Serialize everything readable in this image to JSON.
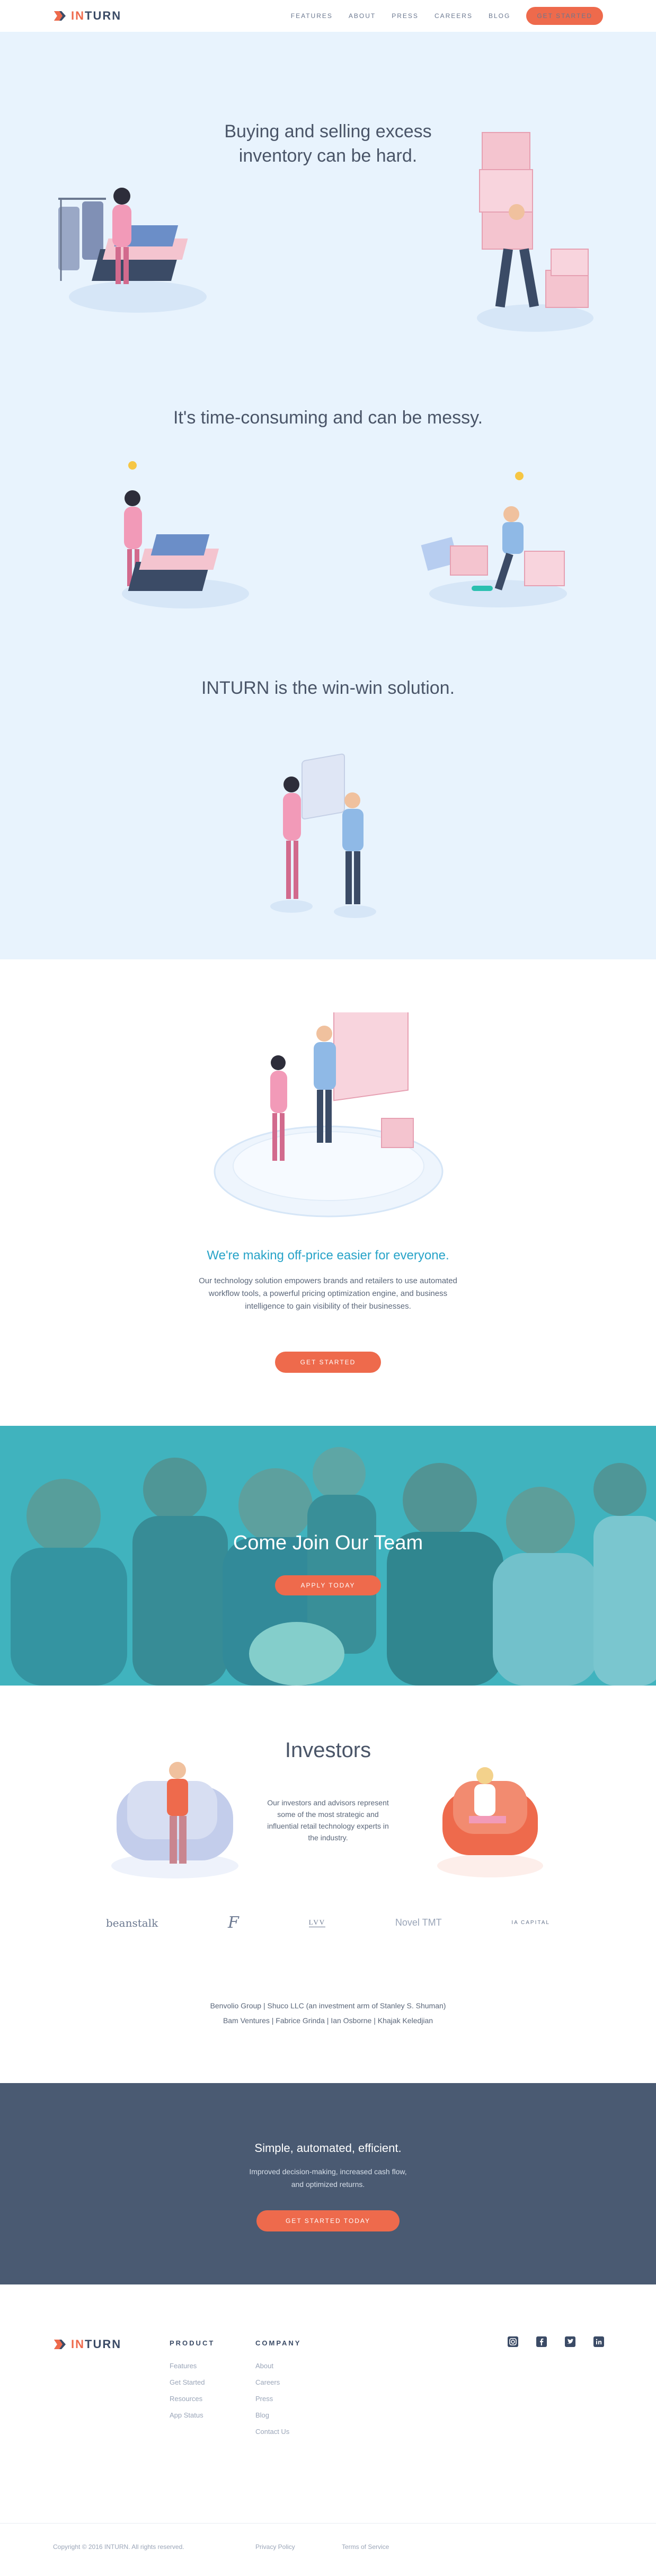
{
  "brand": {
    "name_prefix": "IN",
    "name_suffix": "TURN",
    "accent": "#ee6a4c",
    "dark": "#3b4b66",
    "teal": "#27a3c8"
  },
  "nav": {
    "items": [
      "FEATURES",
      "ABOUT",
      "PRESS",
      "CAREERS",
      "BLOG"
    ],
    "cta": "GET STARTED"
  },
  "hero": {
    "headline_1": "Buying and selling excess",
    "headline_2": "inventory can be hard.",
    "headline_3": "It's time-consuming and can be messy.",
    "headline_4": "INTURN is the win-win solution."
  },
  "offprice": {
    "tagline": "We're making off-price easier for everyone.",
    "description": "Our technology solution empowers brands and retailers to use automated workflow tools, a powerful pricing optimization engine, and business intelligence to gain visibility of their businesses.",
    "cta": "GET STARTED"
  },
  "team": {
    "title": "Come Join Our Team",
    "cta": "APPLY TODAY"
  },
  "investors": {
    "title": "Investors",
    "description": "Our investors and advisors represent some of the most strategic and influential retail technology experts in the industry.",
    "logos": [
      "beanstalk",
      "F",
      "LVV",
      "Novel TMT",
      "IA CAPITAL"
    ],
    "names_line_1": "Benvolio Group  |  Shuco LLC (an investment arm of Stanley S. Shuman)",
    "names_line_2": "Bam Ventures  |  Fabrice Grinda  |  Ian Osborne  |  Khajak Keledjian"
  },
  "closing": {
    "title": "Simple, automated, efficient.",
    "description_1": "Improved decision-making, increased cash flow,",
    "description_2": "and optimized returns.",
    "cta": "GET STARTED TODAY"
  },
  "footer": {
    "product_heading": "PRODUCT",
    "product_links": [
      "Features",
      "Get Started",
      "Resources",
      "App Status"
    ],
    "company_heading": "COMPANY",
    "company_links": [
      "About",
      "Careers",
      "Press",
      "Blog",
      "Contact Us"
    ],
    "social": [
      "instagram-icon",
      "facebook-icon",
      "twitter-icon",
      "linkedin-icon"
    ],
    "copyright": "Copyright © 2016 INTURN. All rights reserved.",
    "privacy": "Privacy Policy",
    "terms": "Terms of Service"
  }
}
